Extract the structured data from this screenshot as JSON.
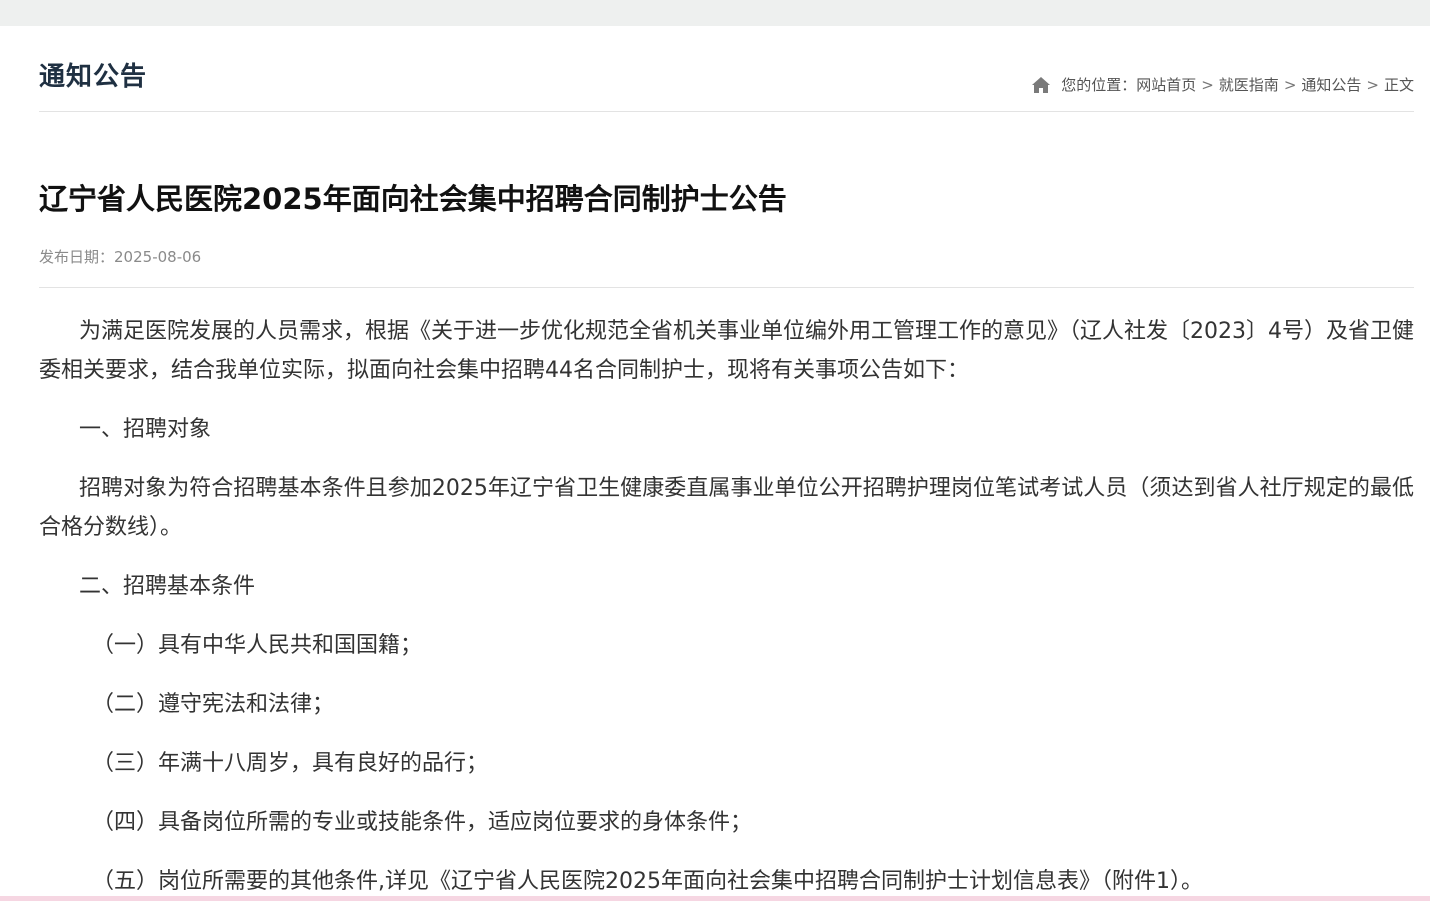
{
  "section": {
    "title": "通知公告"
  },
  "breadcrumb": {
    "prefix": "您的位置：",
    "items": [
      "网站首页",
      "就医指南",
      "通知公告",
      "正文"
    ],
    "separator": ">"
  },
  "article": {
    "title": "辽宁省人民医院2025年面向社会集中招聘合同制护士公告",
    "date_label": "发布日期：",
    "date": "2025-08-06",
    "paragraphs": [
      "为满足医院发展的人员需求，根据《关于进一步优化规范全省机关事业单位编外用工管理工作的意见》（辽人社发〔2023〕4号）及省卫健委相关要求，结合我单位实际，拟面向社会集中招聘44名合同制护士，现将有关事项公告如下：",
      "一、招聘对象",
      "招聘对象为符合招聘基本条件且参加2025年辽宁省卫生健康委直属事业单位公开招聘护理岗位笔试考试人员（须达到省人社厅规定的最低合格分数线）。",
      "二、招聘基本条件",
      "（一）具有中华人民共和国国籍；",
      "（二）遵守宪法和法律；",
      "（三）年满十八周岁，具有良好的品行；",
      "（四）具备岗位所需的专业或技能条件，适应岗位要求的身体条件；",
      "（五）岗位所需要的其他条件,详见《辽宁省人民医院2025年面向社会集中招聘合同制护士计划信息表》（附件1）。"
    ]
  },
  "colors": {
    "section_title": "#1f3042",
    "body_text": "#333333",
    "meta_text": "#8a8a8a",
    "divider": "#e3e3e3"
  },
  "icons": {
    "breadcrumb": "home-icon"
  }
}
